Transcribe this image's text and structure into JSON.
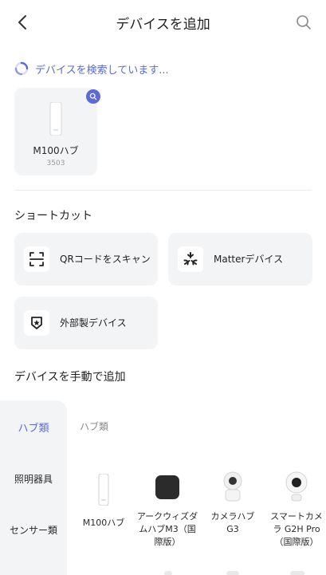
{
  "header": {
    "title": "デバイスを追加"
  },
  "scan": {
    "status_text": "デバイスを検索しています..."
  },
  "found_device": {
    "name": "M100ハブ",
    "code": "3503"
  },
  "shortcuts": {
    "section_title": "ショートカット",
    "items": [
      {
        "label": "QRコードをスキャン",
        "icon": "qr-scan-icon"
      },
      {
        "label": "Matterデバイス",
        "icon": "matter-icon"
      },
      {
        "label": "外部製デバイス",
        "icon": "shield-star-icon"
      }
    ]
  },
  "manual": {
    "section_title": "デバイスを手動で追加",
    "categories": [
      {
        "label": "ハブ類",
        "active": true
      },
      {
        "label": "照明器具",
        "active": false
      },
      {
        "label": "センサー類",
        "active": false
      }
    ],
    "subcategory_title": "ハブ類",
    "devices": [
      {
        "name": "M100ハブ"
      },
      {
        "name": "アークウィズダムハブM3（国際版）"
      },
      {
        "name": "カメラハブG3"
      },
      {
        "name": "スマートカメラ G2H Pro（国際版）"
      }
    ]
  },
  "colors": {
    "accent": "#5b6ad8",
    "card_background": "#f3f4f6"
  }
}
